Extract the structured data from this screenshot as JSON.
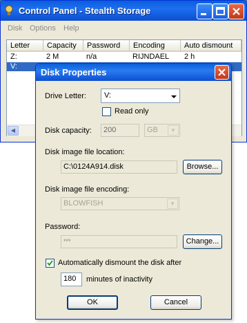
{
  "main_window": {
    "title": "Control Panel - Stealth Storage",
    "menu": [
      "Disk",
      "Options",
      "Help"
    ],
    "columns": [
      "Letter",
      "Capacity",
      "Password",
      "Encoding",
      "Auto dismount"
    ],
    "rows": [
      [
        "Z:",
        "2 M",
        "n/a",
        "RIJNDAEL",
        "2 h"
      ],
      [
        "V:",
        "",
        "",
        "",
        ""
      ]
    ]
  },
  "dialog": {
    "title": "Disk Properties",
    "drive_letter_label": "Drive Letter:",
    "drive_letter_value": "V:",
    "read_only_label": "Read only",
    "read_only_checked": false,
    "capacity_label": "Disk capacity:",
    "capacity_value": "200",
    "capacity_unit": "GB",
    "location_label": "Disk image file location:",
    "location_value": "C:\\0124A914.disk",
    "browse_label": "Browse...",
    "encoding_label": "Disk image file encoding:",
    "encoding_value": "BLOWFISH",
    "password_label": "Password:",
    "password_value": "***",
    "change_label": "Change...",
    "auto_dismount_label": "Automatically dismount the disk after",
    "auto_dismount_checked": true,
    "minutes_value": "180",
    "minutes_label": "minutes of inactivity",
    "ok_label": "OK",
    "cancel_label": "Cancel"
  },
  "colors": {
    "titlebar": "#0a5fd8",
    "selection": "#316ac5",
    "dialog_bg": "#ece9d8"
  }
}
